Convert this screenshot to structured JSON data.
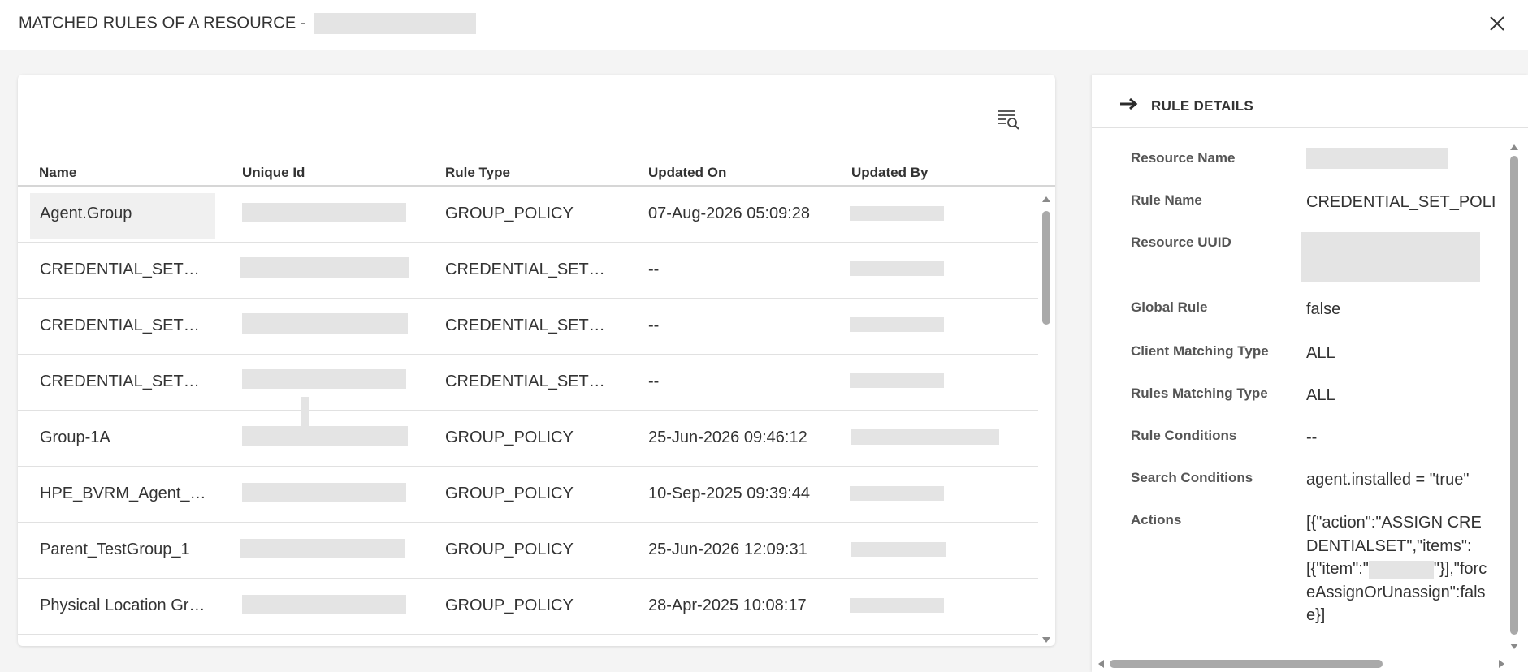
{
  "modal": {
    "title": "MATCHED RULES OF A RESOURCE - ",
    "close_icon": "close-icon"
  },
  "table": {
    "filter_icon": "filter-search-icon",
    "columns": [
      "Name",
      "Unique Id",
      "Rule Type",
      "Updated On",
      "Updated By"
    ],
    "rows": [
      {
        "name": "Agent.Group",
        "rule_type": "GROUP_POLICY",
        "updated_on": "07-Aug-2026 05:09:28"
      },
      {
        "name": "CREDENTIAL_SET_POLICY",
        "rule_type": "CREDENTIAL_SET_POLICY",
        "updated_on": "--"
      },
      {
        "name": "CREDENTIAL_SET_POLICY",
        "rule_type": "CREDENTIAL_SET_POLICY",
        "updated_on": "--"
      },
      {
        "name": "CREDENTIAL_SET_POLICY",
        "rule_type": "CREDENTIAL_SET_POLICY",
        "updated_on": "--"
      },
      {
        "name": "Group-1A",
        "rule_type": "GROUP_POLICY",
        "updated_on": "25-Jun-2026 09:46:12"
      },
      {
        "name": "HPE_BVRM_Agent_Group",
        "rule_type": "GROUP_POLICY",
        "updated_on": "10-Sep-2025 09:39:44"
      },
      {
        "name": "Parent_TestGroup_1",
        "rule_type": "GROUP_POLICY",
        "updated_on": "25-Jun-2026 12:09:31"
      },
      {
        "name": "Physical Location Group",
        "rule_type": "GROUP_POLICY",
        "updated_on": "28-Apr-2025 10:08:17"
      }
    ]
  },
  "details": {
    "title": "RULE DETAILS",
    "arrow_icon": "arrow-right-icon",
    "labels": {
      "resource_name": "Resource Name",
      "rule_name": "Rule Name",
      "resource_uuid": "Resource UUID",
      "global_rule": "Global Rule",
      "client_matching_type": "Client Matching Type",
      "rules_matching_type": "Rules Matching Type",
      "rule_conditions": "Rule Conditions",
      "search_conditions": "Search Conditions",
      "actions": "Actions"
    },
    "values": {
      "rule_name": "CREDENTIAL_SET_POLI",
      "global_rule": "false",
      "client_matching_type": "ALL",
      "rules_matching_type": "ALL",
      "rule_conditions": "--",
      "search_conditions": "agent.installed = \"true\"",
      "actions_prefix": "[{\"action\":\"ASSIGN CREDENTIALSET\",\"items\": [{\"item\":\"",
      "actions_suffix": "\"}],\"forceAssignOrUnassign\":false}]"
    }
  }
}
